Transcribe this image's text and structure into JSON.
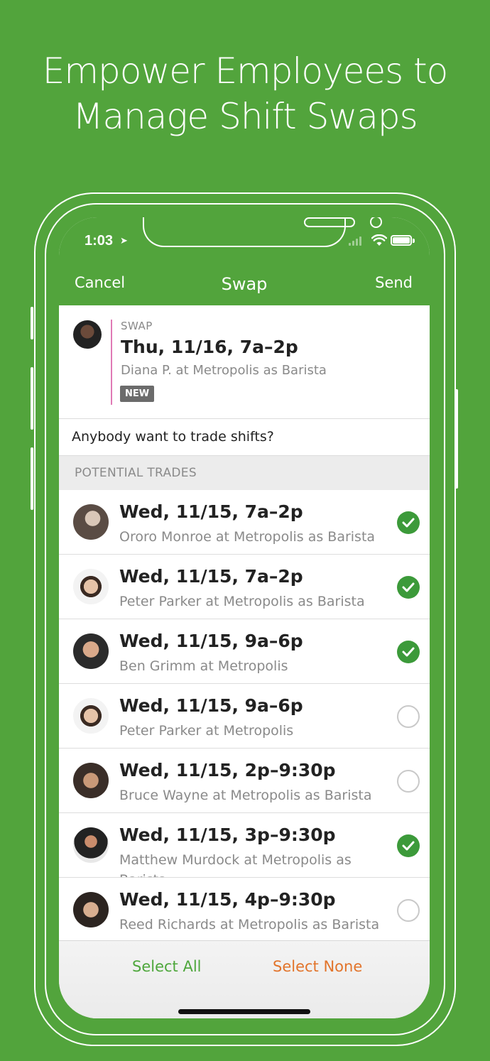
{
  "headline": {
    "line1": "Empower Employees to",
    "line2": "Manage Shift Swaps"
  },
  "status_bar": {
    "time": "1:03",
    "location_icon": "location-arrow-icon"
  },
  "nav": {
    "cancel": "Cancel",
    "title": "Swap",
    "send": "Send"
  },
  "swap": {
    "label": "SWAP",
    "date": "Thu, 11/16, 7a–2p",
    "description": "Diana P. at Metropolis as Barista",
    "badge": "NEW"
  },
  "message": "Anybody want to trade shifts?",
  "section_header": "POTENTIAL TRADES",
  "trades": [
    {
      "date": "Wed, 11/15, 7a–2p",
      "description": "Ororo Monroe at Metropolis as Barista",
      "selected": true
    },
    {
      "date": "Wed, 11/15, 7a–2p",
      "description": "Peter Parker at Metropolis as Barista",
      "selected": true
    },
    {
      "date": "Wed, 11/15, 9a–6p",
      "description": "Ben Grimm at Metropolis",
      "selected": true
    },
    {
      "date": "Wed, 11/15, 9a–6p",
      "description": "Peter Parker at Metropolis",
      "selected": false
    },
    {
      "date": "Wed, 11/15, 2p–9:30p",
      "description": "Bruce Wayne at Metropolis as Barista",
      "selected": false
    },
    {
      "date": "Wed, 11/15, 3p–9:30p",
      "description": "Matthew Murdock at Metropolis as Barista",
      "selected": true
    },
    {
      "date": "Wed, 11/15, 4p–9:30p",
      "description": "Reed Richards at Metropolis as Barista",
      "selected": false
    }
  ],
  "toolbar": {
    "select_all": "Select All",
    "select_none": "Select None"
  },
  "colors": {
    "brand_green": "#52a43c",
    "check_green": "#3c9a3a",
    "select_none_orange": "#e2742b",
    "swap_accent_pink": "#e07ab5"
  }
}
